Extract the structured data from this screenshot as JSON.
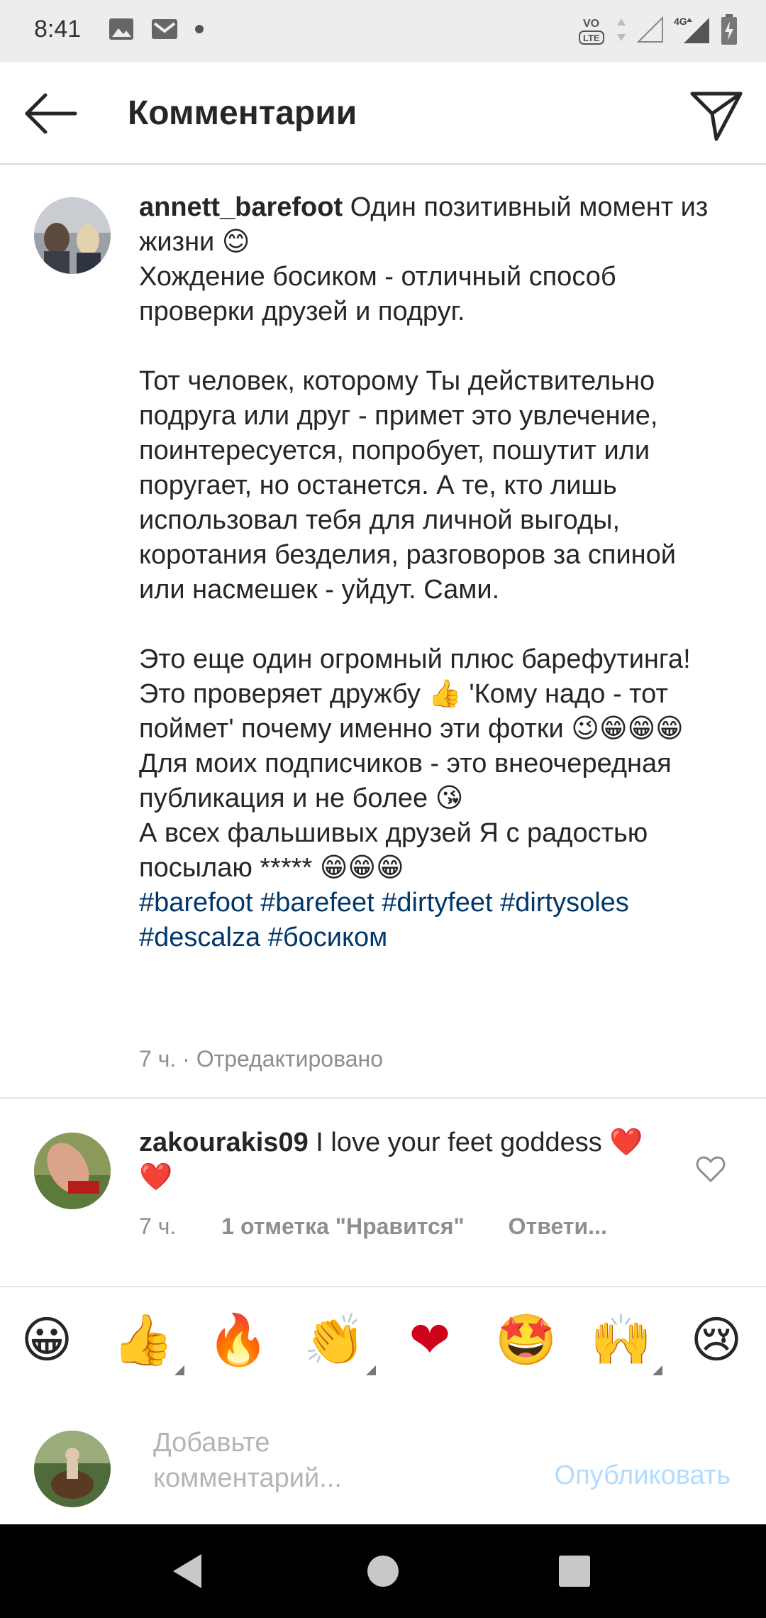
{
  "status_bar": {
    "time": "8:41",
    "icons_left": [
      "image-icon",
      "gmail-icon",
      "dot-icon"
    ],
    "icons_right": [
      "volte-icon",
      "data-arrows-icon",
      "signal-empty-icon",
      "4g-signal-icon",
      "battery-charging-icon"
    ],
    "network_label": "4G",
    "volte_label": "VO LTE"
  },
  "header": {
    "title": "Комментарии"
  },
  "post": {
    "username": "annett_barefoot",
    "text": " Один позитивный момент из жизни 😊\nХождение босиком - отличный способ проверки друзей и подруг.\n\nТот человек, которому Ты действительно подруга или друг - примет это увлечение, поинтересуется, попробует, пошутит или поругает, но останется. А те, кто лишь использовал тебя для личной выгоды, коротания безделия, разговоров за спиной или насмешек - уйдут. Сами.\n\nЭто еще один огромный плюс барефутинга! Это проверяет дружбу 👍 'Кому надо - тот поймет' почему именно эти фотки 😉😁😁😁 Для моих подписчиков - это внеочередная публикация и не более 😘\nА всех фальшивых друзей Я с радостью посылаю ***** 😁😁😁\n",
    "hashtags": [
      "#barefoot",
      "#barefeet",
      "#dirtyfeet",
      "#dirtysoles",
      "#descalza",
      "#босиком"
    ],
    "meta": "7 ч. · Отредактировано"
  },
  "comment": {
    "username": "zakourakis09",
    "text": " I love your feet goddess ❤️❤️",
    "time": "7 ч.",
    "likes": "1 отметка \"Нравится\"",
    "reply": "Ответи..."
  },
  "emoji_bar": [
    {
      "icon": "grinning-face-emoji",
      "char": "😀",
      "has_variants": false
    },
    {
      "icon": "thumbs-up-emoji",
      "char": "👍",
      "has_variants": true
    },
    {
      "icon": "fire-emoji",
      "char": "🔥",
      "has_variants": false
    },
    {
      "icon": "clapping-hands-emoji",
      "char": "👏",
      "has_variants": true
    },
    {
      "icon": "red-heart-emoji",
      "char": "❤",
      "has_variants": false
    },
    {
      "icon": "star-struck-emoji",
      "char": "🤩",
      "has_variants": false
    },
    {
      "icon": "raising-hands-emoji",
      "char": "🙌",
      "has_variants": true
    },
    {
      "icon": "crying-face-emoji",
      "char": "😢",
      "has_variants": false
    }
  ],
  "compose": {
    "placeholder": "Добавьте комментарий...",
    "publish_label": "Опубликовать"
  },
  "colors": {
    "hashtag": "#00376b",
    "publish_disabled": "#b3dbff",
    "meta_gray": "#8e8e8e",
    "status_bar_bg": "#ededed",
    "nav_bar_bg": "#000000"
  }
}
